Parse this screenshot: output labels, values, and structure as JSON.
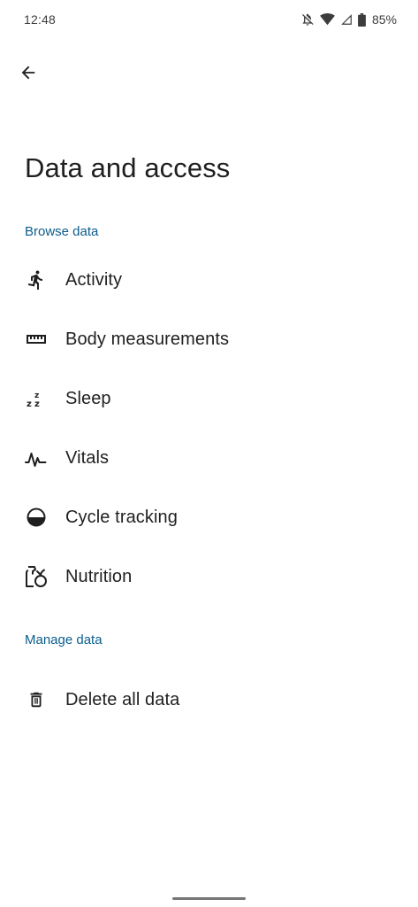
{
  "status_bar": {
    "time": "12:48",
    "battery": "85%"
  },
  "page": {
    "title": "Data and access"
  },
  "browse_section": {
    "header": "Browse data",
    "items": [
      {
        "label": "Activity",
        "icon": "running-person-icon"
      },
      {
        "label": "Body measurements",
        "icon": "ruler-icon"
      },
      {
        "label": "Sleep",
        "icon": "sleep-zzz-icon"
      },
      {
        "label": "Vitals",
        "icon": "vitals-pulse-icon"
      },
      {
        "label": "Cycle tracking",
        "icon": "half-circle-icon"
      },
      {
        "label": "Nutrition",
        "icon": "nutrition-icon"
      }
    ]
  },
  "manage_section": {
    "header": "Manage data",
    "items": [
      {
        "label": "Delete all data",
        "icon": "trash-icon"
      }
    ]
  },
  "colors": {
    "accent": "#0b5d8c",
    "text": "#1f1f1f",
    "background": "#ffffff"
  }
}
